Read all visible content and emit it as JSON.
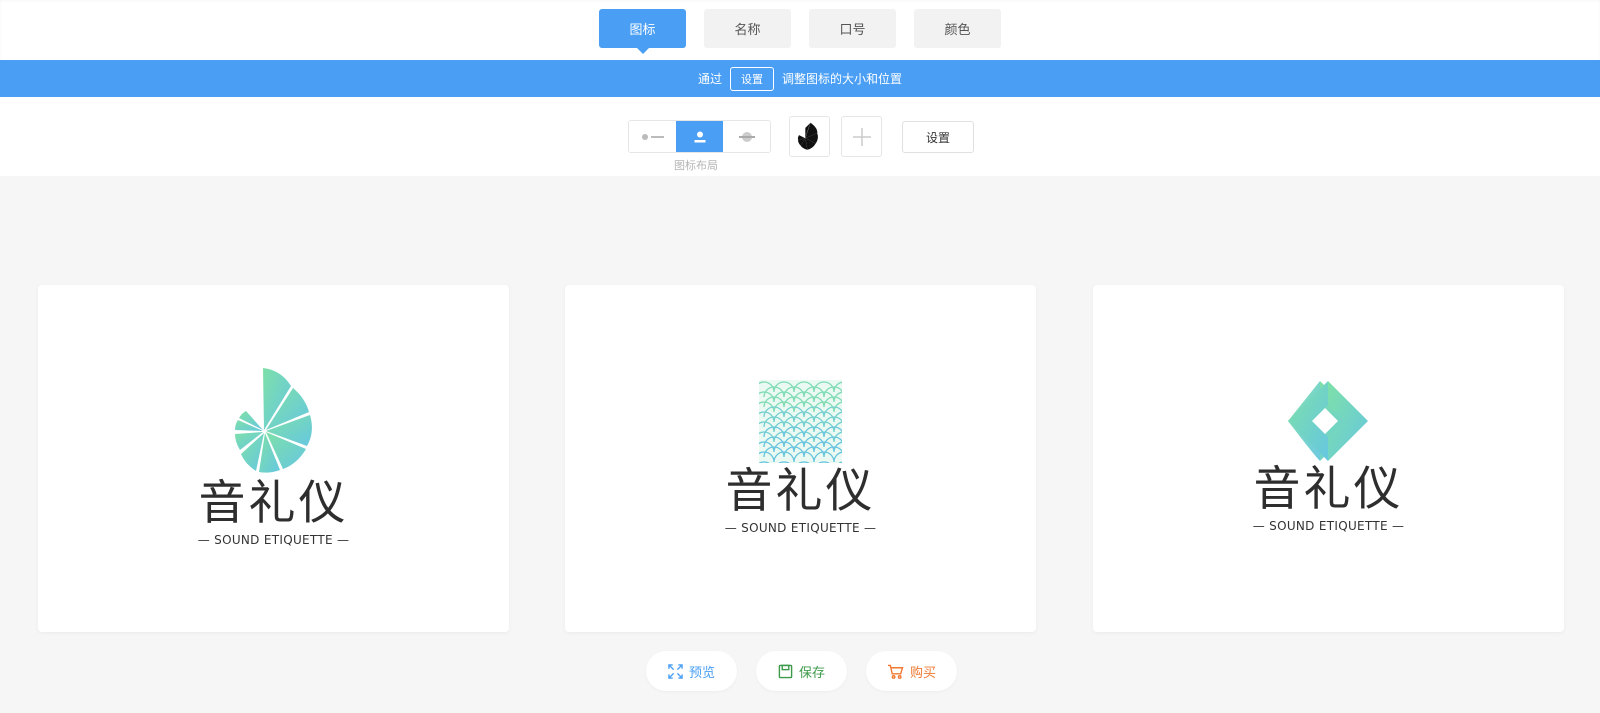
{
  "tabs": [
    {
      "label": "图标",
      "active": true
    },
    {
      "label": "名称",
      "active": false
    },
    {
      "label": "口号",
      "active": false
    },
    {
      "label": "颜色",
      "active": false
    }
  ],
  "hint": {
    "prefix": "通过",
    "button": "设置",
    "suffix": "调整图标的大小和位置"
  },
  "toolbar": {
    "layout_caption": "图标布局",
    "settings_label": "设置",
    "active_layout": "icon-top"
  },
  "cards": [
    {
      "name": "音礼仪",
      "slogan": "— SOUND ETIQUETTE —",
      "icon": "shell-fan-icon"
    },
    {
      "name": "音礼仪",
      "slogan": "— SOUND ETIQUETTE —",
      "icon": "wave-pattern-icon"
    },
    {
      "name": "音礼仪",
      "slogan": "— SOUND ETIQUETTE —",
      "icon": "diamond-icon"
    }
  ],
  "actions": {
    "preview": "预览",
    "save": "保存",
    "buy": "购买"
  },
  "colors": {
    "accent": "#4a9ff5",
    "gradient_start": "#7ee0a8",
    "gradient_end": "#66c7e0",
    "preview_color": "#4a9ff5",
    "save_color": "#3d9a4a",
    "buy_color": "#f07830"
  }
}
